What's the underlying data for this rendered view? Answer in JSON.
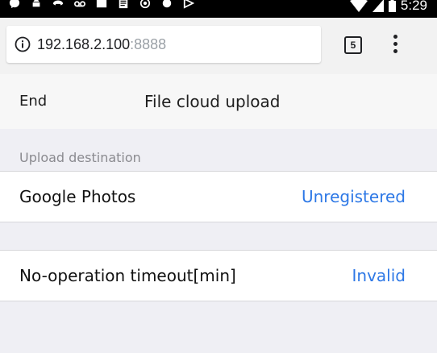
{
  "status_bar": {
    "time": "5:29",
    "icons": [
      "messenger-icon",
      "android-icon",
      "voicemail-icon",
      "cast-icon",
      "image-icon",
      "document-icon",
      "security-icon",
      "record-icon",
      "play-store-icon"
    ],
    "right_icons": [
      "wifi-icon",
      "signal-icon",
      "battery-icon"
    ]
  },
  "browser": {
    "url_host": "192.168.2.100",
    "url_port": ":8888",
    "tab_count": "5"
  },
  "header": {
    "end_label": "End",
    "title": "File cloud upload"
  },
  "upload_section": {
    "header": "Upload destination",
    "google_photos": {
      "label": "Google Photos",
      "value": "Unregistered"
    }
  },
  "timeout_setting": {
    "label": "No-operation timeout[min]",
    "value": "Invalid"
  },
  "colors": {
    "accent": "#2d78e6",
    "background": "#efeff4",
    "header_bg": "#f7f7f7"
  }
}
